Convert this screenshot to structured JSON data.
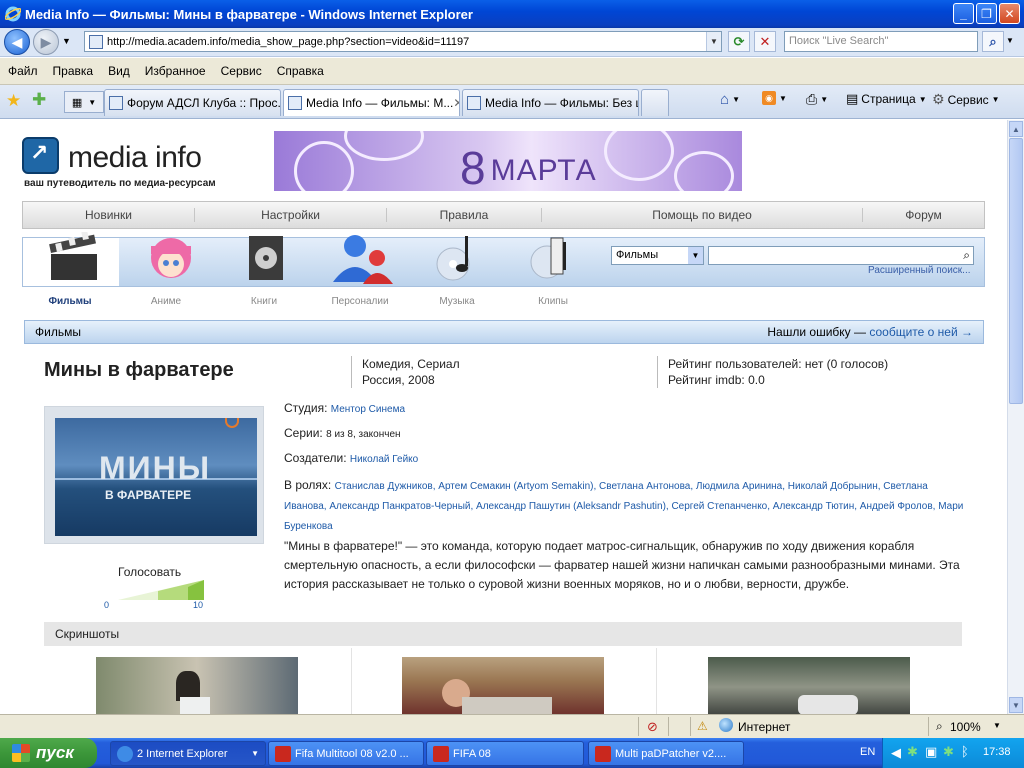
{
  "window": {
    "title": "Media Info — Фильмы: Мины в фарватере - Windows Internet Explorer"
  },
  "addressbar": {
    "url": "http://media.academ.info/media_show_page.php?section=video&id=11197",
    "search_placeholder": "Поиск \"Live Search\""
  },
  "menu": [
    "Файл",
    "Правка",
    "Вид",
    "Избранное",
    "Сервис",
    "Справка"
  ],
  "tabs": [
    {
      "label": "Форум АДСЛ Клуба :: Прос..."
    },
    {
      "label": "Media Info — Фильмы: М..."
    },
    {
      "label": "Media Info — Фильмы: Без ц..."
    }
  ],
  "toolbar": {
    "page_label": "Страница",
    "tools_label": "Сервис"
  },
  "site": {
    "logo_name": "media info",
    "slogan": "ваш путеводитель по медиа-ресурсам",
    "banner_text_num": "8",
    "banner_text_word": "МАРТА",
    "topnav": [
      "Новинки",
      "Настройки",
      "Правила",
      "Помощь по видео",
      "Форум"
    ],
    "categories": [
      "Фильмы",
      "Аниме",
      "Книги",
      "Персоналии",
      "Музыка",
      "Клипы"
    ],
    "search_select": "Фильмы",
    "advanced_search": "Расширенный поиск..."
  },
  "section": {
    "name": "Фильмы",
    "error_prefix": "Нашли ошибку —",
    "error_link": "сообщите о ней →"
  },
  "movie": {
    "title": "Мины в фарватере",
    "genre": "Комедия, Сериал",
    "country_year": "Россия, 2008",
    "user_rating": "Рейтинг пользователей: нет (0 голосов)",
    "imdb_rating": "Рейтинг imdb: 0.0",
    "poster_line1": "МИНЫ",
    "poster_line2": "В ФАРВАТЕРЕ",
    "studio_label": "Студия:",
    "studio": "Ментор Синема",
    "series_label": "Серии:",
    "series": "8 из 8, закончен",
    "creators_label": "Создатели:",
    "creators": "Николай Гейко",
    "cast_label": "В ролях:",
    "cast": "Станислав Дужников, Артем Семакин (Artyom Semakin), Светлана Антонова, Людмила Аринина, Николай Добрынин, Светлана Иванова, Александр Панкратов-Черный, Александр Пашутин (Aleksandr Pashutin), Сергей Степанченко, Александр Тютин, Андрей Фролов, Мари Буренкова",
    "description": "\"Мины в фарватере!\" — это команда, которую подает матрос-сигнальщик, обнаружив по ходу движения корабля смертельную опасность, а если философски — фарватер нашей жизни напичкан самыми разнообразными минами. Эта история рассказывает не только о суровой жизни военных моряков, но и о любви, верности, дружбе.",
    "vote_label": "Голосовать",
    "vote_min": "0",
    "vote_max": "10",
    "screenshots_label": "Скриншоты"
  },
  "statusbar": {
    "zone": "Интернет",
    "zoom": "100%"
  },
  "taskbar": {
    "start": "пуск",
    "items": [
      "2 Internet Explorer",
      "Fifa Multitool 08 v2.0 ...",
      "FIFA 08",
      "Multi paDPatcher v2...."
    ],
    "lang": "EN",
    "clock": "17:38"
  },
  "colors": {
    "link": "#1e5aa8",
    "accent": "#245fdc"
  }
}
